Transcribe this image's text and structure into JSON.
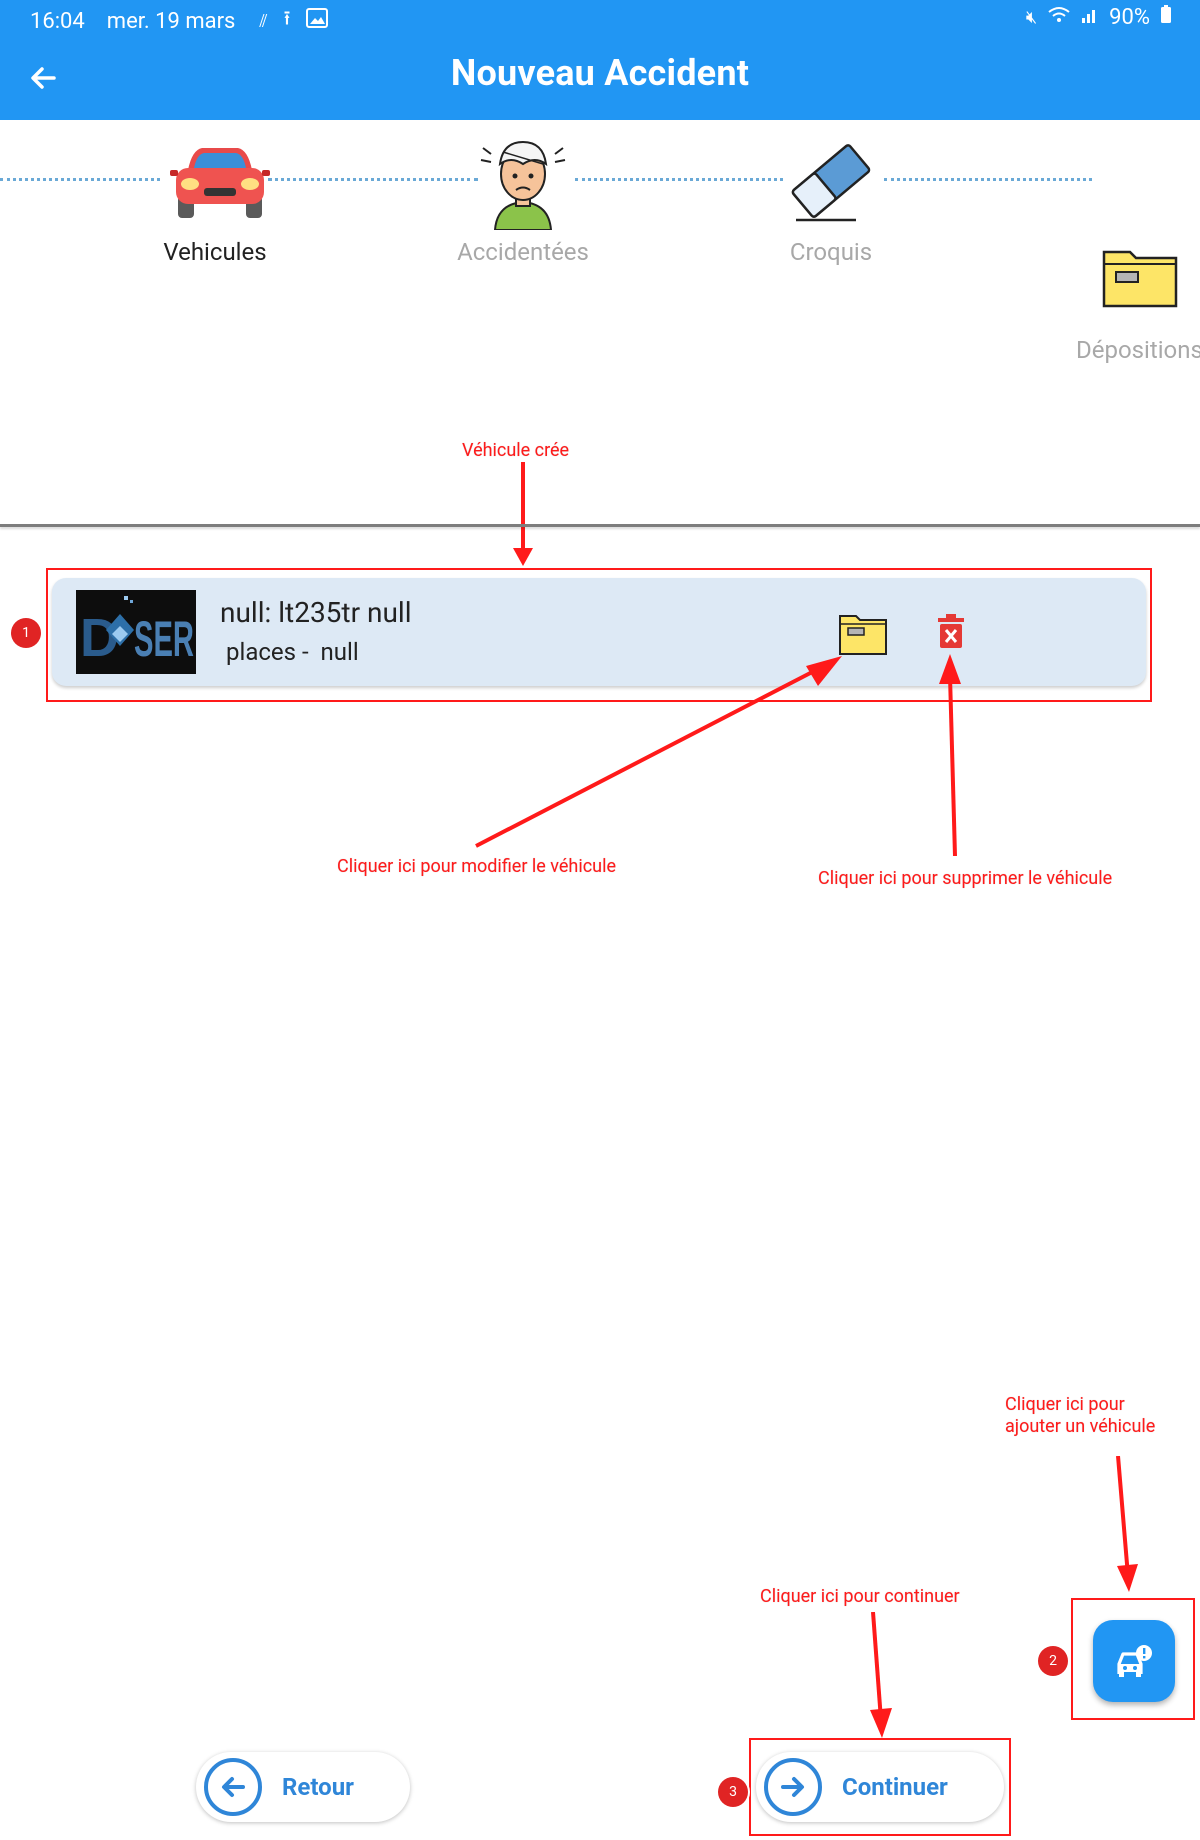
{
  "status_bar": {
    "time": "16:04",
    "date": "mer. 19 mars",
    "battery": "90%"
  },
  "app_bar": {
    "title": "Nouveau Accident",
    "back_icon": "arrow-left-icon"
  },
  "stepper": {
    "steps": [
      {
        "label": "Vehicules",
        "icon": "car-icon",
        "state": "active"
      },
      {
        "label": "Accidentées",
        "icon": "injured-person-icon",
        "state": "inactive"
      },
      {
        "label": "Croquis",
        "icon": "eraser-icon",
        "state": "inactive"
      },
      {
        "label": "Dépositions",
        "icon": "folder-icon",
        "state": "inactive"
      }
    ]
  },
  "vehicle_card": {
    "title": "null: lt235tr null",
    "subtitle": "places -  null",
    "logo_text": "DOSER",
    "edit_icon": "folder-icon",
    "delete_icon": "trash-icon"
  },
  "annotations": {
    "created": "Véhicule crée",
    "edit": "Cliquer ici pour modifier le véhicule",
    "delete": "Cliquer ici pour supprimer le véhicule",
    "add_line1": "Cliquer ici pour",
    "add_line2": "ajouter un véhicule",
    "continue": "Cliquer ici pour continuer",
    "badge1": "1",
    "badge2": "2",
    "badge3": "3"
  },
  "buttons": {
    "back_label": "Retour",
    "continue_label": "Continuer",
    "fab_icon": "car-alert-icon"
  },
  "colors": {
    "primary": "#2196f3",
    "annotation_red": "#ff1a1a",
    "card_bg": "#dde9f5",
    "button_text": "#2f86d8"
  }
}
